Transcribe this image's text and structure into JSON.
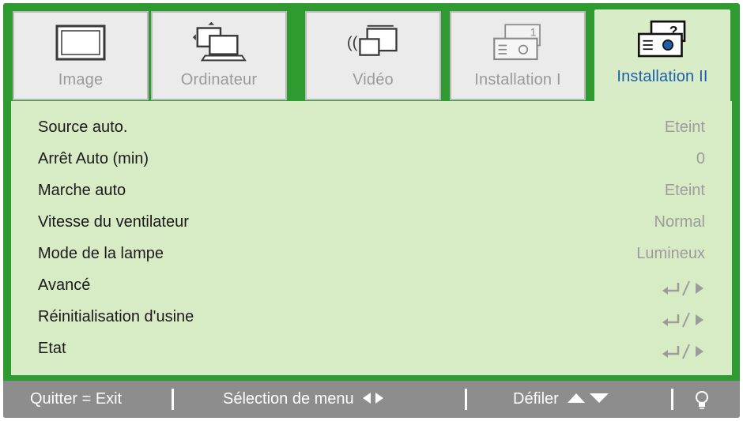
{
  "tabs": [
    {
      "label": "Image",
      "icon": "monitor-icon",
      "active": false
    },
    {
      "label": "Ordinateur",
      "icon": "computer-icon",
      "active": false
    },
    {
      "label": "Vidéo",
      "icon": "video-icon",
      "active": false
    },
    {
      "label": "Installation I",
      "icon": "projector-icon",
      "active": false
    },
    {
      "label": "Installation II",
      "icon": "projector-help-icon",
      "active": true
    }
  ],
  "rows": [
    {
      "name": "Source auto.",
      "value": "Eteint"
    },
    {
      "name": "Arrêt Auto (min)",
      "value": "0"
    },
    {
      "name": "Marche auto",
      "value": "Eteint"
    },
    {
      "name": "Vitesse du ventilateur",
      "value": "Normal"
    },
    {
      "name": "Mode de la lampe",
      "value": "Lumineux"
    },
    {
      "name": "Avancé",
      "value": ""
    },
    {
      "name": "Réinitialisation d'usine",
      "value": ""
    },
    {
      "name": "Etat",
      "value": ""
    }
  ],
  "footer": {
    "quit": "Quitter = Exit",
    "menu_select": "Sélection de menu",
    "scroll": "Défiler"
  },
  "colors": {
    "frame": "#2f9a2f",
    "panel": "#d7ecc5",
    "active_label": "#1c5fa8",
    "footer": "#8d8d8d"
  }
}
